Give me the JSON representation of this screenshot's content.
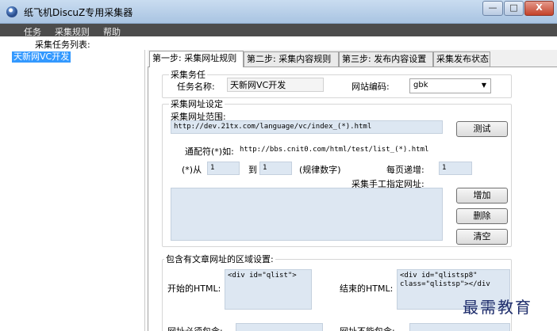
{
  "window": {
    "title": "纸飞机DiscuZ专用采集器",
    "min_glyph": "—",
    "max_glyph": "□",
    "close_glyph": "X"
  },
  "menu": {
    "items": [
      "任务",
      "采集规则",
      "帮助"
    ]
  },
  "task_list": {
    "label": "采集任务列表:",
    "items": [
      "天新网VC开发"
    ]
  },
  "tabs": [
    {
      "label": "第一步: 采集网址规则",
      "active": true
    },
    {
      "label": "第二步: 采集内容规则",
      "active": false
    },
    {
      "label": "第三步: 发布内容设置",
      "active": false
    },
    {
      "label": "采集发布状态",
      "active": false
    }
  ],
  "task_group": {
    "legend": "采集务任",
    "name_label": "任务名称:",
    "name_value": "天新网VC开发",
    "encoding_label": "网站编码:",
    "encoding_value": "gbk"
  },
  "url_group": {
    "legend": "采集网址设定",
    "range_label": "采集网址范围:",
    "range_value": "http://dev.21tx.com/language/vc/index_(*).html",
    "test_button": "测试",
    "wildcard_label": "通配符(*)如:",
    "wildcard_example": "http://bbs.cnit0.com/html/test/list_(*).html",
    "from_label": "(*)从",
    "from_value": "1",
    "to_label": "到",
    "to_value": "1",
    "rule_hint": "(规律数字)",
    "step_label": "每页递增:",
    "step_value": "1",
    "manual_label": "采集手工指定网址:",
    "manual_value": "",
    "add_button": "增加",
    "delete_button": "删除",
    "clear_button": "清空"
  },
  "region_group": {
    "legend": "包含有文章网址的区域设置:",
    "start_label": "开始的HTML:",
    "start_value": "<div id=\"qlist\">",
    "end_label": "结束的HTML:",
    "end_value": "<div id=\"qlistsp8\"\nclass=\"qlistsp\"></div",
    "must_label": "网址必须包含:",
    "must_not_label": "网址不能包含:"
  },
  "watermark": "最需教育"
}
